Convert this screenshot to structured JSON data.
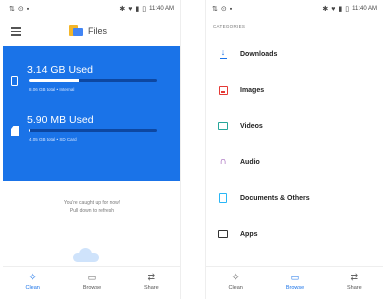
{
  "left": {
    "status": {
      "time": "11:40 AM"
    },
    "app": {
      "title": "Files"
    },
    "storage": [
      {
        "used": "3.14 GB Used",
        "total": "8.06 GB total • Internal",
        "fill_fraction": 0.39
      },
      {
        "used": "5.90 MB Used",
        "total": "4.05 GB total • SD Card",
        "fill_fraction": 0.01
      }
    ],
    "empty_state": {
      "line1": "You're caught up for now!",
      "line2": "Pull down to refresh"
    },
    "nav": [
      {
        "label": "Clean",
        "icon": "clean-icon",
        "active": true
      },
      {
        "label": "Browse",
        "icon": "folder-icon",
        "active": false
      },
      {
        "label": "Share",
        "icon": "share-icon",
        "active": false
      }
    ]
  },
  "right": {
    "status": {
      "time": "11:40 AM"
    },
    "section_header": "CATEGORIES",
    "categories": [
      {
        "label": "Downloads",
        "icon": "download-icon",
        "color": "#1a73e8"
      },
      {
        "label": "Images",
        "icon": "image-icon",
        "color": "#e53935"
      },
      {
        "label": "Videos",
        "icon": "video-icon",
        "color": "#26a69a"
      },
      {
        "label": "Audio",
        "icon": "headphones-icon",
        "color": "#8e44ad"
      },
      {
        "label": "Documents & Others",
        "icon": "document-icon",
        "color": "#29b6f6"
      },
      {
        "label": "Apps",
        "icon": "apps-icon",
        "color": "#333333"
      }
    ],
    "nav": [
      {
        "label": "Clean",
        "icon": "clean-icon",
        "active": false
      },
      {
        "label": "Browse",
        "icon": "folder-icon",
        "active": true
      },
      {
        "label": "Share",
        "icon": "share-icon",
        "active": false
      }
    ]
  },
  "colors": {
    "accent": "#1a73e8",
    "panel_dark": "#0d47a1"
  }
}
